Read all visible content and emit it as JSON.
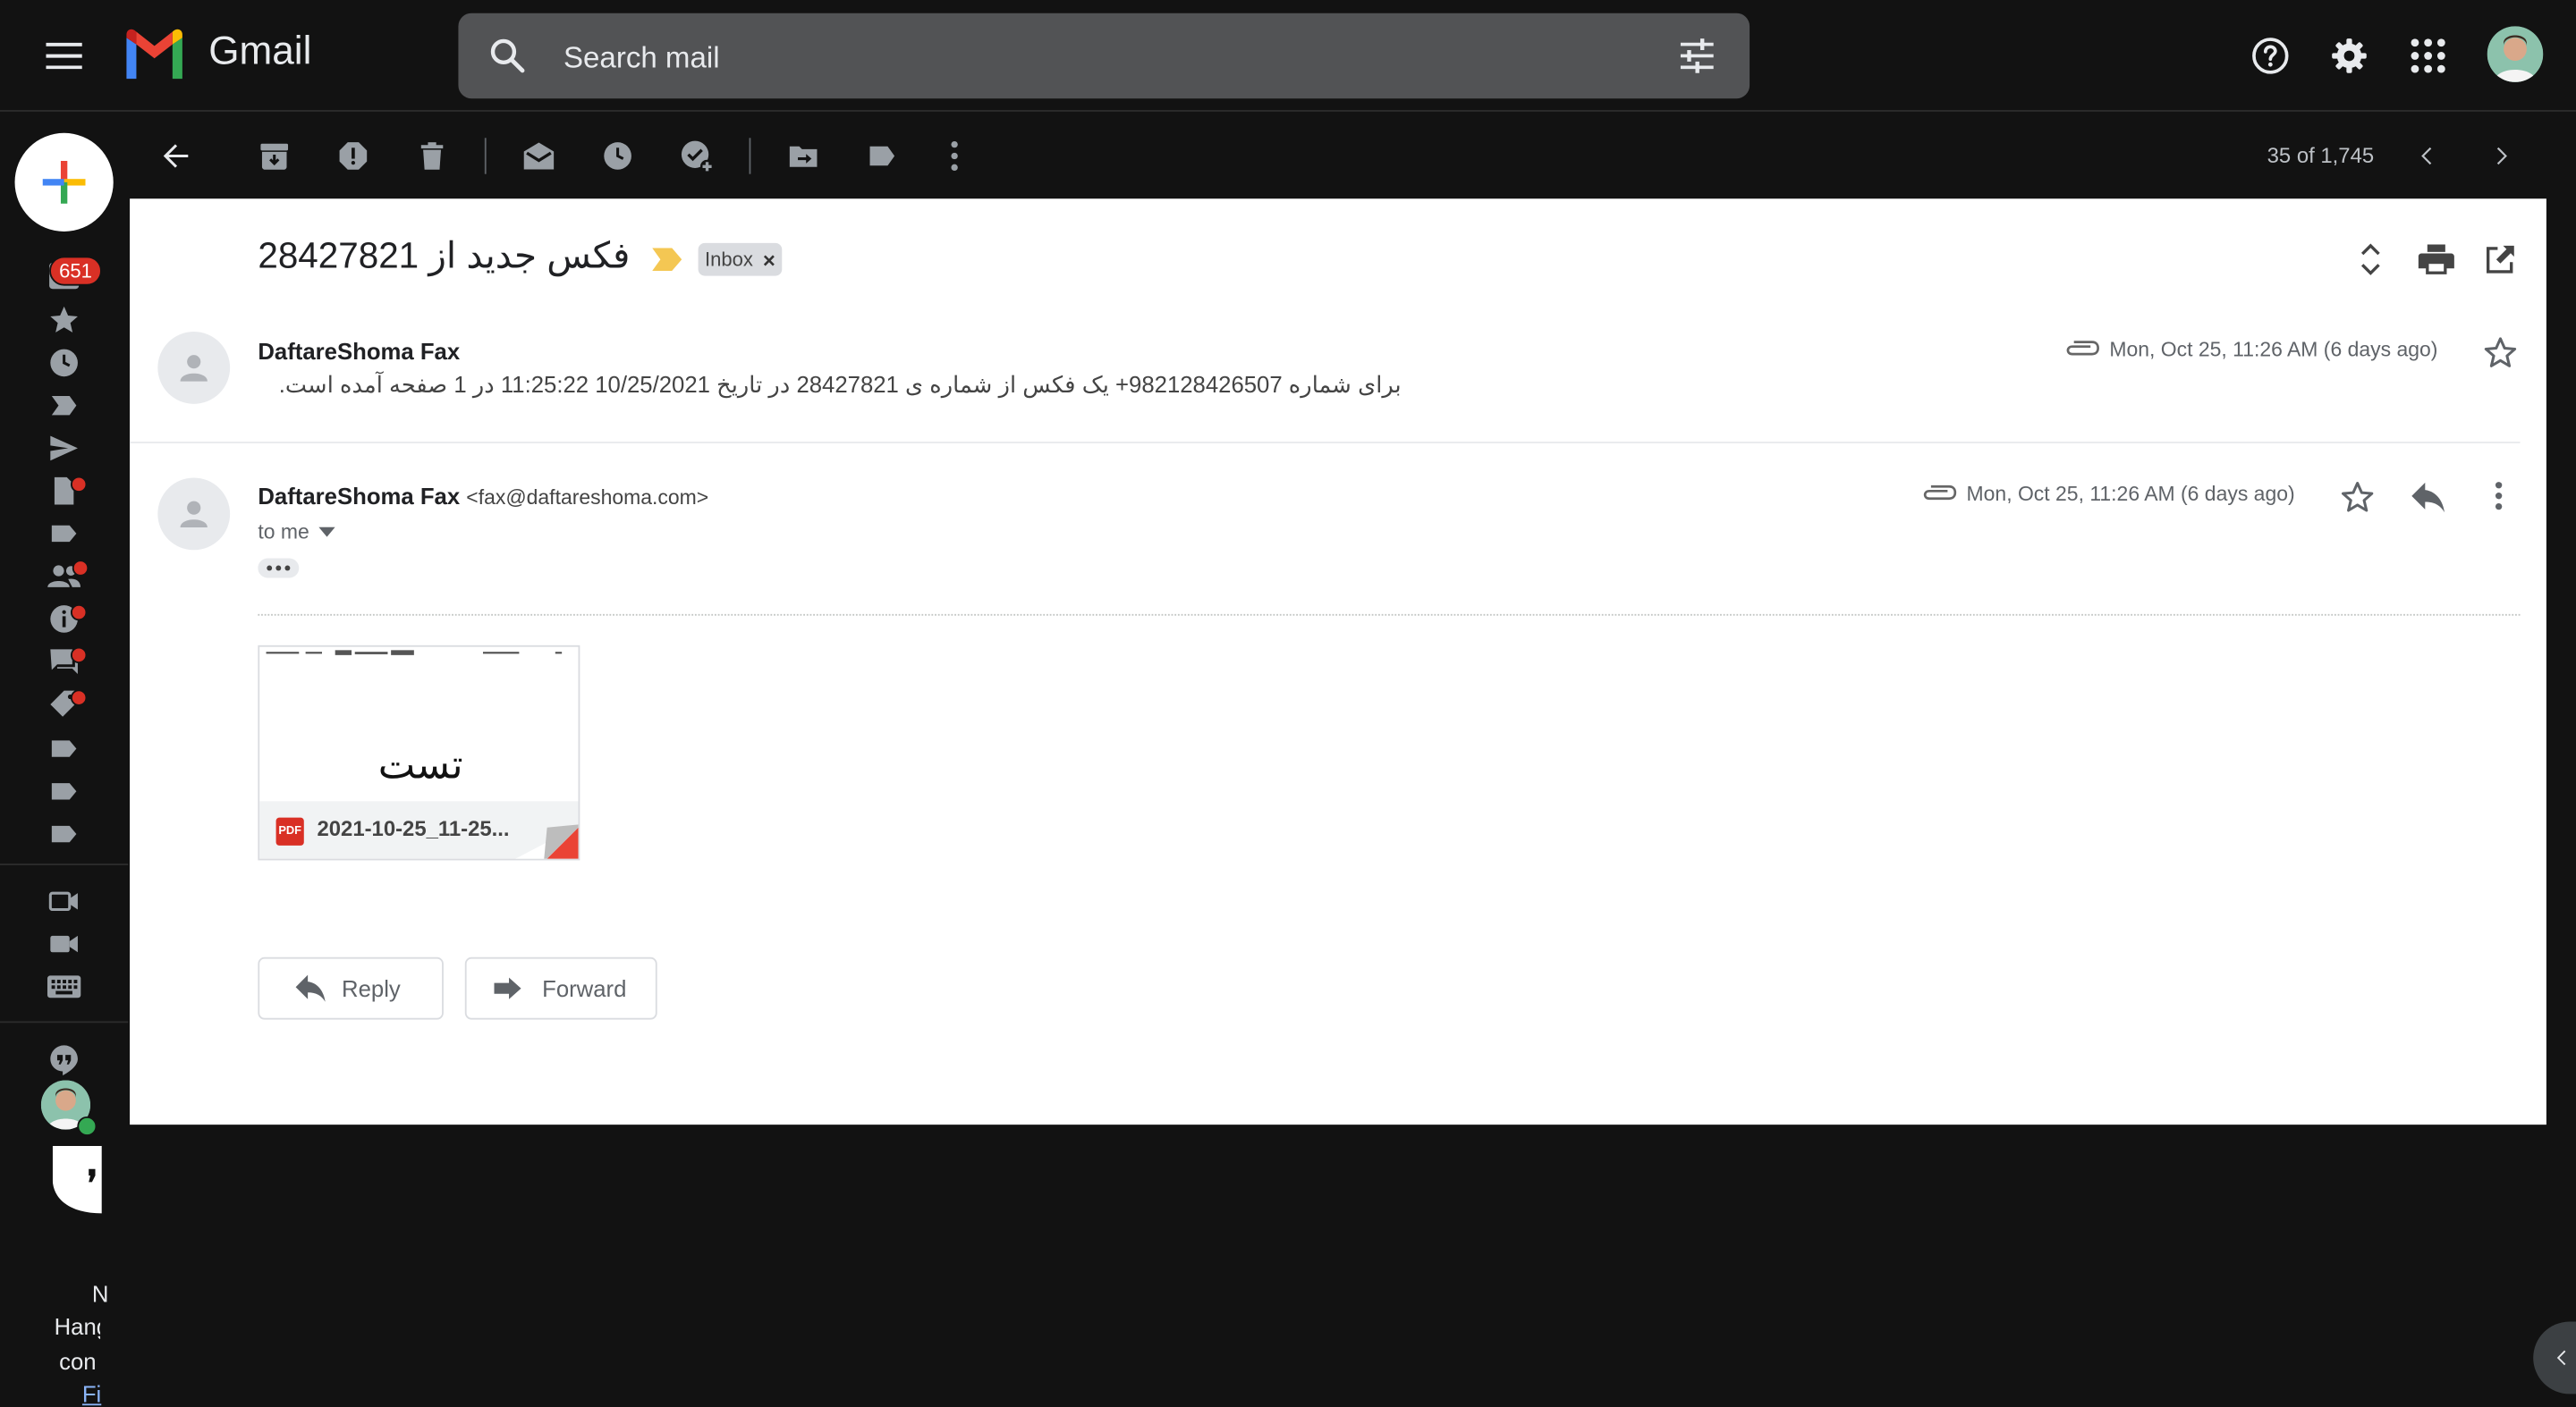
{
  "header": {
    "app_name": "Gmail",
    "search_placeholder": "Search mail"
  },
  "sidebar": {
    "inbox_badge": "651",
    "bottom_text": [
      "N",
      "Hang",
      "con",
      "Fi"
    ]
  },
  "toolbar": {
    "pagination": "35 of 1,745"
  },
  "thread": {
    "subject": "فکس جدید از 28427821",
    "label": "Inbox",
    "messages": [
      {
        "sender": "DaftareShoma Fax",
        "snippet": "برای شماره 982128426507+ یک فکس از شماره ی 28427821 در تاریخ 10/25/2021 11:25:22 در 1 صفحه آمده است.",
        "date": "Mon, Oct 25, 11:26 AM (6 days ago)"
      },
      {
        "sender": "DaftareShoma Fax",
        "email": "<fax@daftareshoma.com>",
        "to": "to me",
        "date": "Mon, Oct 25, 11:26 AM (6 days ago)",
        "attachment": {
          "filename": "2021-10-25_11-25...",
          "preview_text": "تست",
          "type_label": "PDF"
        }
      }
    ]
  },
  "actions": {
    "reply": "Reply",
    "forward": "Forward"
  },
  "colors": {
    "background": "#121212",
    "search_bg": "#525355",
    "badge": "#d93025",
    "label_marker": "#f4c753",
    "pdf_red": "#d93025"
  }
}
